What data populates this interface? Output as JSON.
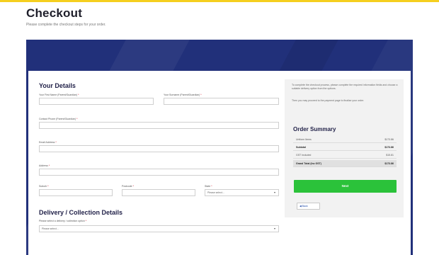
{
  "header": {
    "title": "Checkout",
    "subtitle": "Please complete the checkout steps for your order."
  },
  "details": {
    "title": "Your Details",
    "first_name_label": "Your First Name (Parent/Guardian)",
    "surname_label": "Your Surname (Parent/Guardian)",
    "phone_label": "Contact Phone (Parent/Guardian)",
    "email_label": "Email Address",
    "address_label": "Address",
    "suburb_label": "Suburb",
    "postcode_label": "Postcode",
    "state_label": "State",
    "state_value": "Please select...",
    "required_mark": "*"
  },
  "delivery": {
    "title": "Delivery / Collection Details",
    "option_label": "Please select a delivery / collection option",
    "option_value": "Please select..."
  },
  "sidebar": {
    "info_1": "To complete the checkout process, please complete the required information fields and choose a suitable delivery option from the options.",
    "info_2": "Then you may proceed to the payment page to finalise your order.",
    "summary_title": "Order Summary",
    "rows": [
      {
        "label": "Uniform Items",
        "value": "$173.86"
      },
      {
        "label": "Subtotal",
        "value": "$173.86"
      },
      {
        "label": "GST Included",
        "value": "$15.81"
      },
      {
        "label": "Grand Total (Inc GST)",
        "value": "$173.86"
      }
    ],
    "next_label": "Next",
    "back_label": "◀ Back"
  },
  "colors": {
    "accent_yellow": "#f5cf1f",
    "banner_blue": "#21307a",
    "next_green": "#2bc23a"
  }
}
